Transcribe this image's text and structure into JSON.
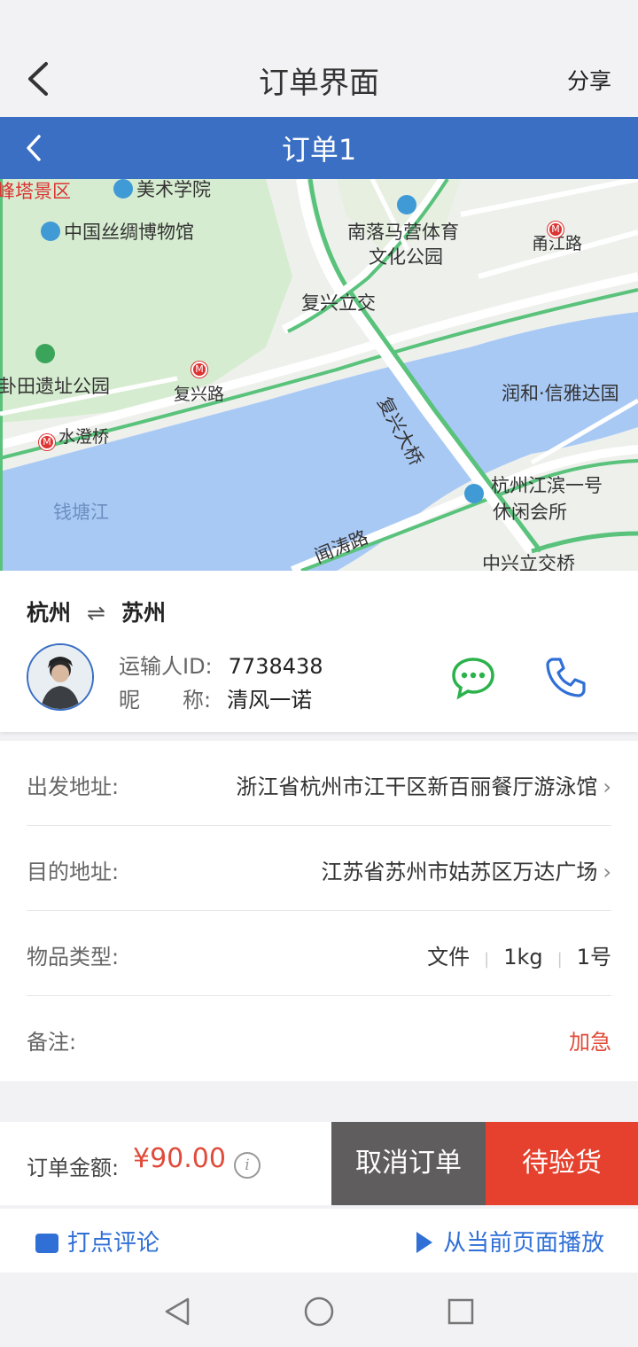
{
  "top_bar": {
    "title": "订单界面",
    "share_label": "分享"
  },
  "order_header": {
    "title": "订单1"
  },
  "map": {
    "labels": {
      "leifeng": "峰塔景区",
      "meishu": "美术学院",
      "silk_museum": "中国丝绸博物馆",
      "nanluoma": "南落马营体育",
      "wenhua_park": "文化公园",
      "yongjiang": "甬江路",
      "fuxing_lijiao": "复兴立交",
      "bagua": "卦田遗址公园",
      "fuxing_road": "复兴路",
      "fuxing_bridge": "复兴大桥",
      "runhe": "润和·信雅达国",
      "shuicheng": "水澄桥",
      "jiangbin": "杭州江滨一号",
      "xiuxian": "休闲会所",
      "qiantang": "钱塘江",
      "wentao": "闻涛路",
      "zhongxing": "中兴立交桥"
    }
  },
  "route": {
    "from": "杭州",
    "to": "苏州",
    "arrow": "⇌"
  },
  "carrier": {
    "id_label": "运输人ID:",
    "id_value": "7738438",
    "nick_label": "昵　　称:",
    "nick_value": "清风一诺"
  },
  "details": [
    {
      "label": "出发地址:",
      "value": "浙江省杭州市江干区新百丽餐厅游泳馆"
    },
    {
      "label": "目的地址:",
      "value": "江苏省苏州市姑苏区万达广场"
    },
    {
      "label": "物品类型:",
      "items": [
        "文件",
        "1kg",
        "1号"
      ]
    },
    {
      "label": "备注:",
      "value": "加急"
    }
  ],
  "bottom": {
    "amount_label": "订单金额:",
    "amount_value": "¥90.00",
    "info_icon": "i",
    "cancel_label": "取消订单",
    "pending_label": "待验货"
  },
  "comment_bar": {
    "comment_label": "打点评论",
    "play_label": "从当前页面播放"
  },
  "colors": {
    "brand_blue": "#3a6fc4",
    "accent_red": "#e5412e",
    "link_blue": "#2f6fd6",
    "dark_gray": "#5f5d5e"
  },
  "icons": [
    "back-icon",
    "message-icon",
    "phone-icon",
    "chevron-right-icon",
    "info-icon",
    "comment-icon",
    "play-icon",
    "nav-back-icon",
    "nav-home-icon",
    "nav-recent-icon"
  ]
}
